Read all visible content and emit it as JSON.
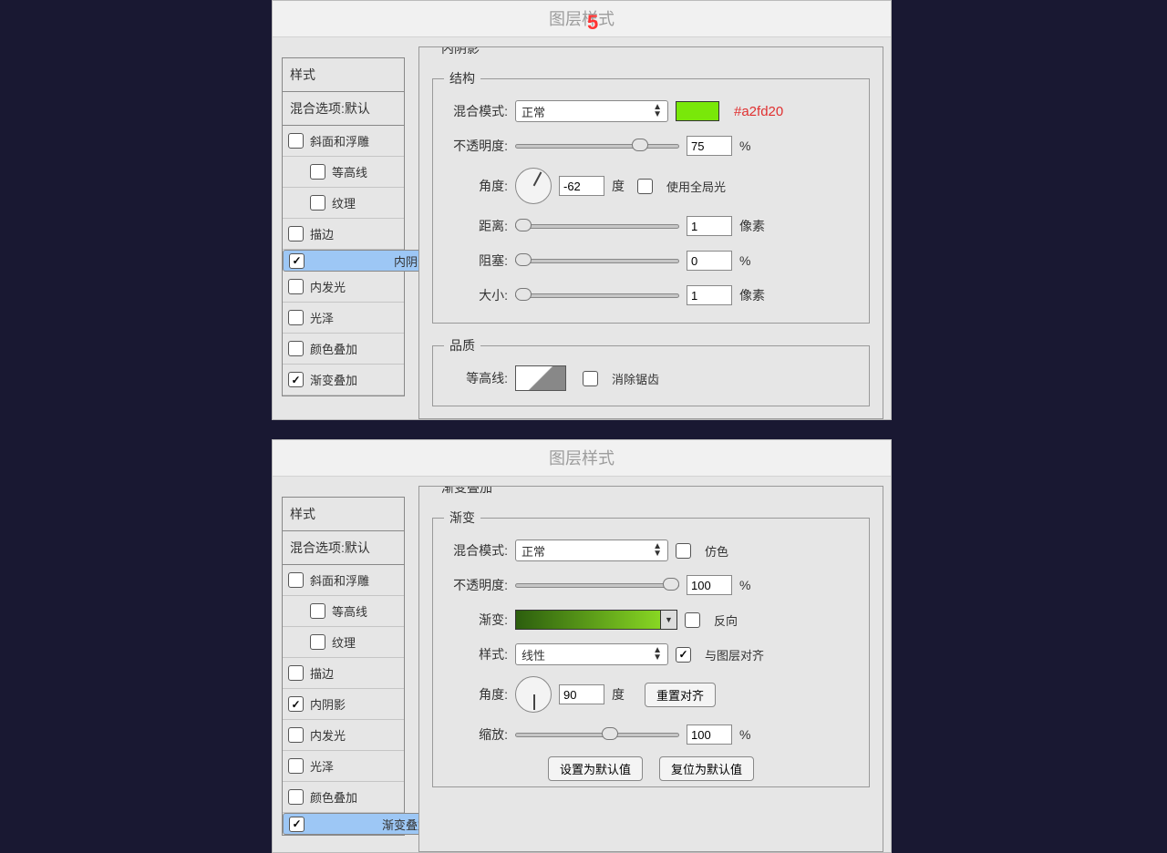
{
  "step_number": "5",
  "title": "图层样式",
  "sidebar": {
    "head_styles": "样式",
    "head_blend": "混合选项:默认",
    "items": [
      {
        "label": "斜面和浮雕",
        "checked": false,
        "indent": false
      },
      {
        "label": "等高线",
        "checked": false,
        "indent": true
      },
      {
        "label": "纹理",
        "checked": false,
        "indent": true
      },
      {
        "label": "描边",
        "checked": false,
        "indent": false
      },
      {
        "label": "内阴影",
        "checked": true,
        "indent": false
      },
      {
        "label": "内发光",
        "checked": false,
        "indent": false
      },
      {
        "label": "光泽",
        "checked": false,
        "indent": false
      },
      {
        "label": "颜色叠加",
        "checked": false,
        "indent": false
      },
      {
        "label": "渐变叠加",
        "checked": true,
        "indent": false
      }
    ]
  },
  "panel1": {
    "section_title": "内阴影",
    "group_struct": "结构",
    "blend_label": "混合模式:",
    "blend_value": "正常",
    "color_hex": "#a2fd20",
    "swatch_color": "#79e809",
    "opacity_label": "不透明度:",
    "opacity_value": "75",
    "percent": "%",
    "angle_label": "角度:",
    "angle_value": "-62",
    "deg": "度",
    "global_light": "使用全局光",
    "dist_label": "距离:",
    "dist_value": "1",
    "px": "像素",
    "choke_label": "阻塞:",
    "choke_value": "0",
    "size_label": "大小:",
    "size_value": "1",
    "group_quality": "品质",
    "contour_label": "等高线:",
    "antialias": "消除锯齿"
  },
  "panel2": {
    "section_title": "渐变叠加",
    "group_grad": "渐变",
    "blend_label": "混合模式:",
    "blend_value": "正常",
    "dither": "仿色",
    "opacity_label": "不透明度:",
    "opacity_value": "100",
    "percent": "%",
    "grad_label": "渐变:",
    "reverse": "反向",
    "style_label": "样式:",
    "style_value": "线性",
    "align": "与图层对齐",
    "angle_label": "角度:",
    "angle_value": "90",
    "deg": "度",
    "reset_align": "重置对齐",
    "scale_label": "缩放:",
    "scale_value": "100",
    "btn_set_default": "设置为默认值",
    "btn_reset_default": "复位为默认值"
  }
}
